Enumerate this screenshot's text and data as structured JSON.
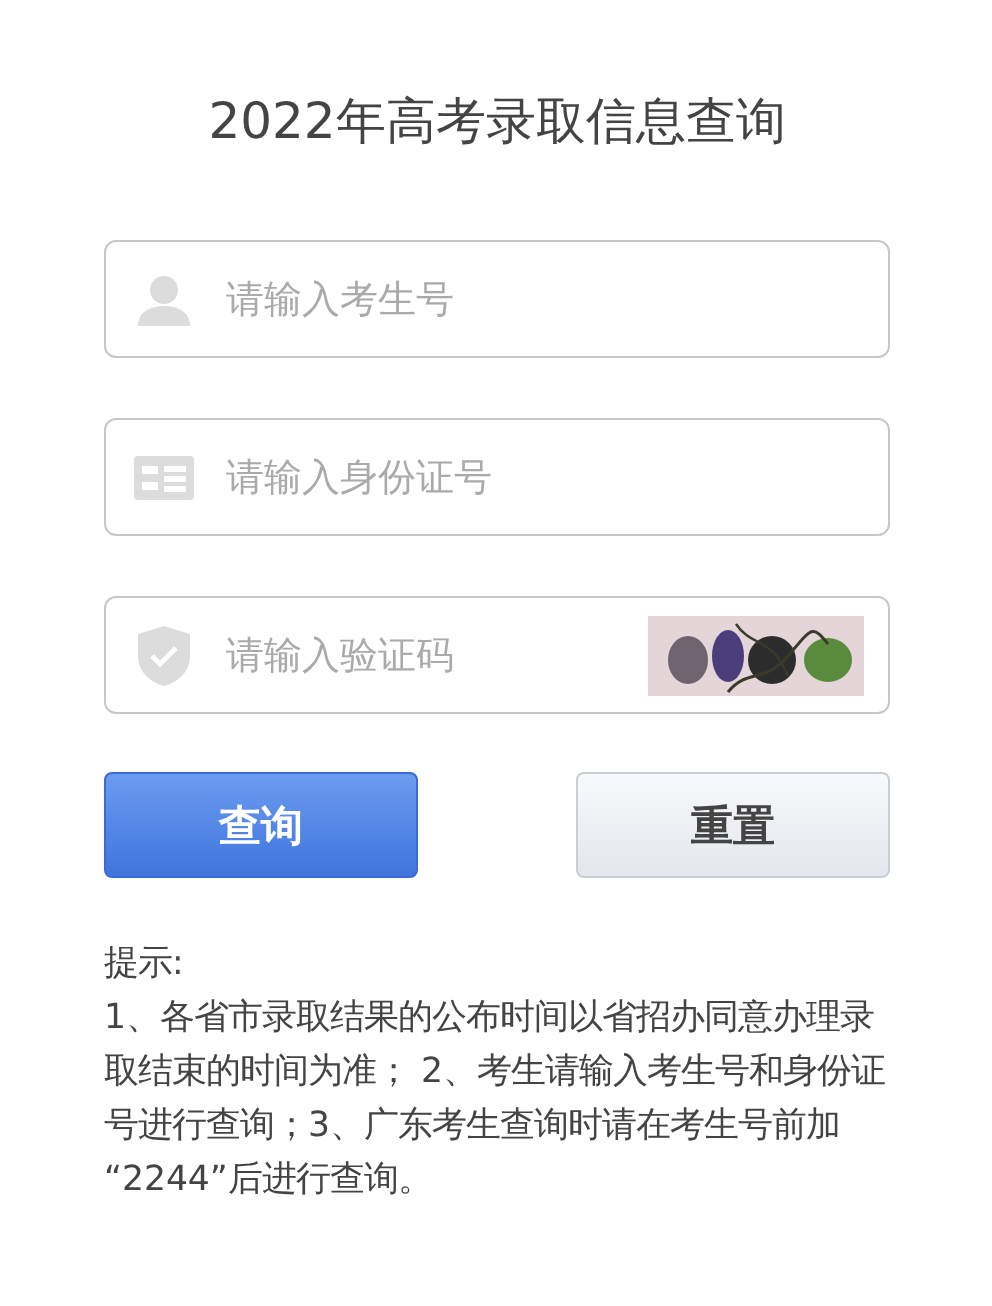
{
  "title": "2022年高考录取信息查询",
  "fields": [
    {
      "kind": "person",
      "placeholder": "请输入考生号"
    },
    {
      "kind": "card",
      "placeholder": "请输入身份证号"
    },
    {
      "kind": "captcha",
      "placeholder": "请输入验证码"
    }
  ],
  "buttons": [
    {
      "kind": "primary",
      "label": "查询"
    },
    {
      "kind": "secondary",
      "label": "重置"
    }
  ],
  "tips": {
    "heading": "提示:",
    "text": "1、各省市录取结果的公布时间以省招办同意办理录取结束的时间为准； 2、考生请输入考生号和身份证号进行查询；3、广东考生查询时请在考生号前加 “2244”后进行查询。"
  }
}
